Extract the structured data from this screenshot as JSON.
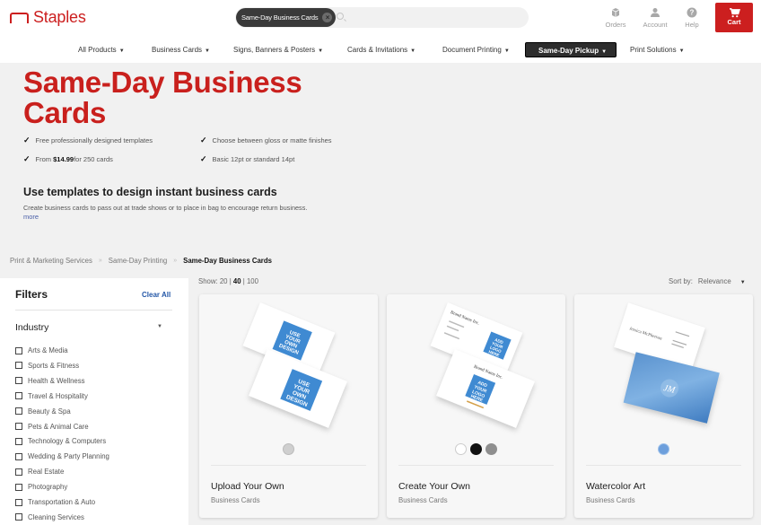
{
  "header": {
    "brand": "Staples",
    "search_chip": "Same-Day Business Cards",
    "search_placeholder": "",
    "utilities": [
      {
        "label": "Orders",
        "icon": "orders-box-icon"
      },
      {
        "label": "Account",
        "icon": "account-person-icon"
      },
      {
        "label": "Help",
        "icon": "help-question-icon"
      }
    ],
    "cart_label": "Cart"
  },
  "nav": [
    {
      "label": "All Products",
      "active": false
    },
    {
      "label": "Business Cards",
      "active": false
    },
    {
      "label": "Signs, Banners & Posters",
      "active": false
    },
    {
      "label": "Cards & Invitations",
      "active": false
    },
    {
      "label": "Document Printing",
      "active": false
    },
    {
      "label": "Same-Day Pickup",
      "active": true
    },
    {
      "label": "Print Solutions",
      "active": false
    }
  ],
  "hero": {
    "title_line1": "Same-Day Business",
    "title_line2": "Cards",
    "features": [
      {
        "text": "Free professionally designed templates"
      },
      {
        "text": "Choose between gloss or matte finishes"
      },
      {
        "prefix": "From ",
        "bold": "$14.99",
        "suffix": " for 250 cards"
      },
      {
        "text": "Basic 12pt or standard 14pt"
      }
    ],
    "subheading": "Use templates to design instant business cards",
    "description": "Create business cards to pass out at trade shows or to place in bag to encourage return business.",
    "more_link": "more"
  },
  "breadcrumb": [
    {
      "label": "Print & Marketing Services"
    },
    {
      "label": "Same-Day Printing"
    },
    {
      "label": "Same-Day Business Cards",
      "current": true
    }
  ],
  "filters": {
    "title": "Filters",
    "clear_all": "Clear All",
    "group_title": "Industry",
    "options": [
      "Arts & Media",
      "Sports & Fitness",
      "Health & Wellness",
      "Travel & Hospitality",
      "Beauty & Spa",
      "Pets & Animal Care",
      "Technology & Computers",
      "Wedding & Party Planning",
      "Real Estate",
      "Photography",
      "Transportation & Auto",
      "Cleaning Services"
    ]
  },
  "toolbar": {
    "show_label": "Show:",
    "show_options": [
      "20",
      "40",
      "100"
    ],
    "show_selected": "40",
    "sort_label": "Sort by:",
    "sort_value": "Relevance"
  },
  "products": [
    {
      "name": "Upload Your Own",
      "category": "Business Cards",
      "image_text": "USE YOUR OWN DESIGN",
      "swatches": [
        "#cfcfcf"
      ]
    },
    {
      "name": "Create Your Own",
      "category": "Business Cards",
      "image_text": "ADD YOUR LOGO HERE",
      "card_brand": "Brand Name Inc.",
      "swatches": [
        "#ffffff",
        "#111111",
        "#8f8f8f"
      ]
    },
    {
      "name": "Watercolor Art",
      "category": "Business Cards",
      "card_person": "Jessica McPherson",
      "swatches": [
        "#6d9fdc"
      ]
    }
  ],
  "colors": {
    "brand_red": "#cc1f1f",
    "link_blue": "#2457a7",
    "card_blue": "#3f8ad2"
  }
}
